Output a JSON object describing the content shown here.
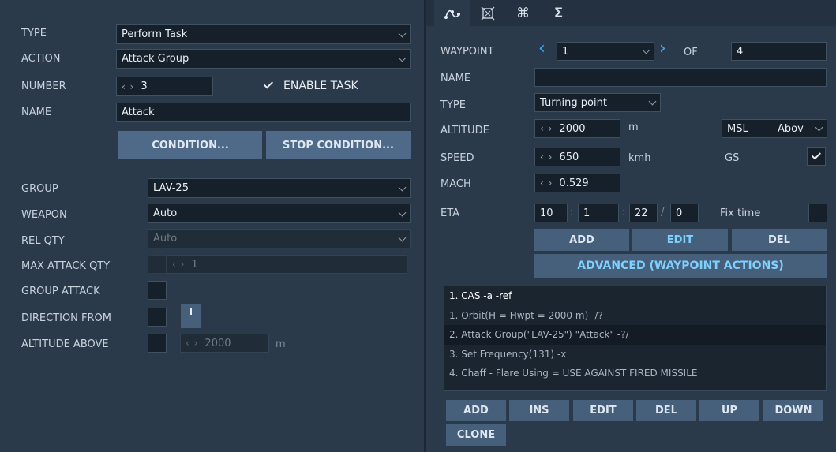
{
  "left": {
    "type_label": "TYPE",
    "type_value": "Perform Task",
    "action_label": "ACTION",
    "action_value": "Attack Group",
    "number_label": "NUMBER",
    "number_value": "3",
    "enable_task_label": "ENABLE TASK",
    "enable_task_checked": true,
    "name_label": "NAME",
    "name_value": "Attack",
    "condition_button": "CONDITION...",
    "stop_condition_button": "STOP CONDITION...",
    "group_label": "GROUP",
    "group_value": "LAV-25",
    "weapon_label": "WEAPON",
    "weapon_value": "Auto",
    "rel_qty_label": "REL QTY",
    "rel_qty_value": "Auto",
    "max_attack_qty_label": "MAX ATTACK QTY",
    "max_attack_qty_value": "1",
    "group_attack_label": "GROUP ATTACK",
    "direction_from_label": "DIRECTION FROM",
    "altitude_above_label": "ALTITUDE ABOVE",
    "altitude_above_value": "2000",
    "altitude_above_unit": "m"
  },
  "tabs": [
    {
      "icon": "route-icon",
      "glyph": "⛭"
    },
    {
      "icon": "target-icon",
      "glyph": "⌧"
    },
    {
      "icon": "command-icon",
      "glyph": "⌘"
    },
    {
      "icon": "sigma-icon",
      "glyph": "Σ"
    }
  ],
  "right": {
    "waypoint_label": "WAYPOINT",
    "waypoint_value": "1",
    "of_label": "OF",
    "waypoint_total": "4",
    "name_label": "NAME",
    "name_value": "",
    "type_label": "TYPE",
    "type_value": "Turning point",
    "altitude_label": "ALTITUDE",
    "altitude_value": "2000",
    "altitude_unit": "m",
    "altitude_ref": "MSL",
    "altitude_ref2": "Abov",
    "speed_label": "SPEED",
    "speed_value": "650",
    "speed_unit": "kmh",
    "gs_label": "GS",
    "gs_checked": true,
    "mach_label": "MACH",
    "mach_value": "0.529",
    "eta_label": "ETA",
    "eta_h": "10",
    "eta_m": "1",
    "eta_s": "22",
    "eta_d": "0",
    "fix_time_label": "Fix time",
    "add_button": "ADD",
    "edit_button": "EDIT",
    "del_button": "DEL",
    "advanced_button": "ADVANCED (WAYPOINT ACTIONS)",
    "actions": [
      "1. CAS -a -ref",
      "1. Orbit(H = Hwpt = 2000 m)  -/?",
      "2. Attack Group(\"LAV-25\") \"Attack\"  -?/",
      "3. Set Frequency(131)  -x",
      "4. Chaff - Flare Using = USE AGAINST FIRED MISSILE"
    ],
    "list_buttons": {
      "add": "ADD",
      "ins": "INS",
      "edit": "EDIT",
      "del": "DEL",
      "up": "UP",
      "down": "DOWN",
      "clone": "CLONE"
    }
  },
  "colors": {
    "background": "#2b3a4b",
    "field": "#16202b",
    "button": "#46607c",
    "accent_text": "#7fd0ff",
    "nav_arrow": "#3fa9f5"
  }
}
